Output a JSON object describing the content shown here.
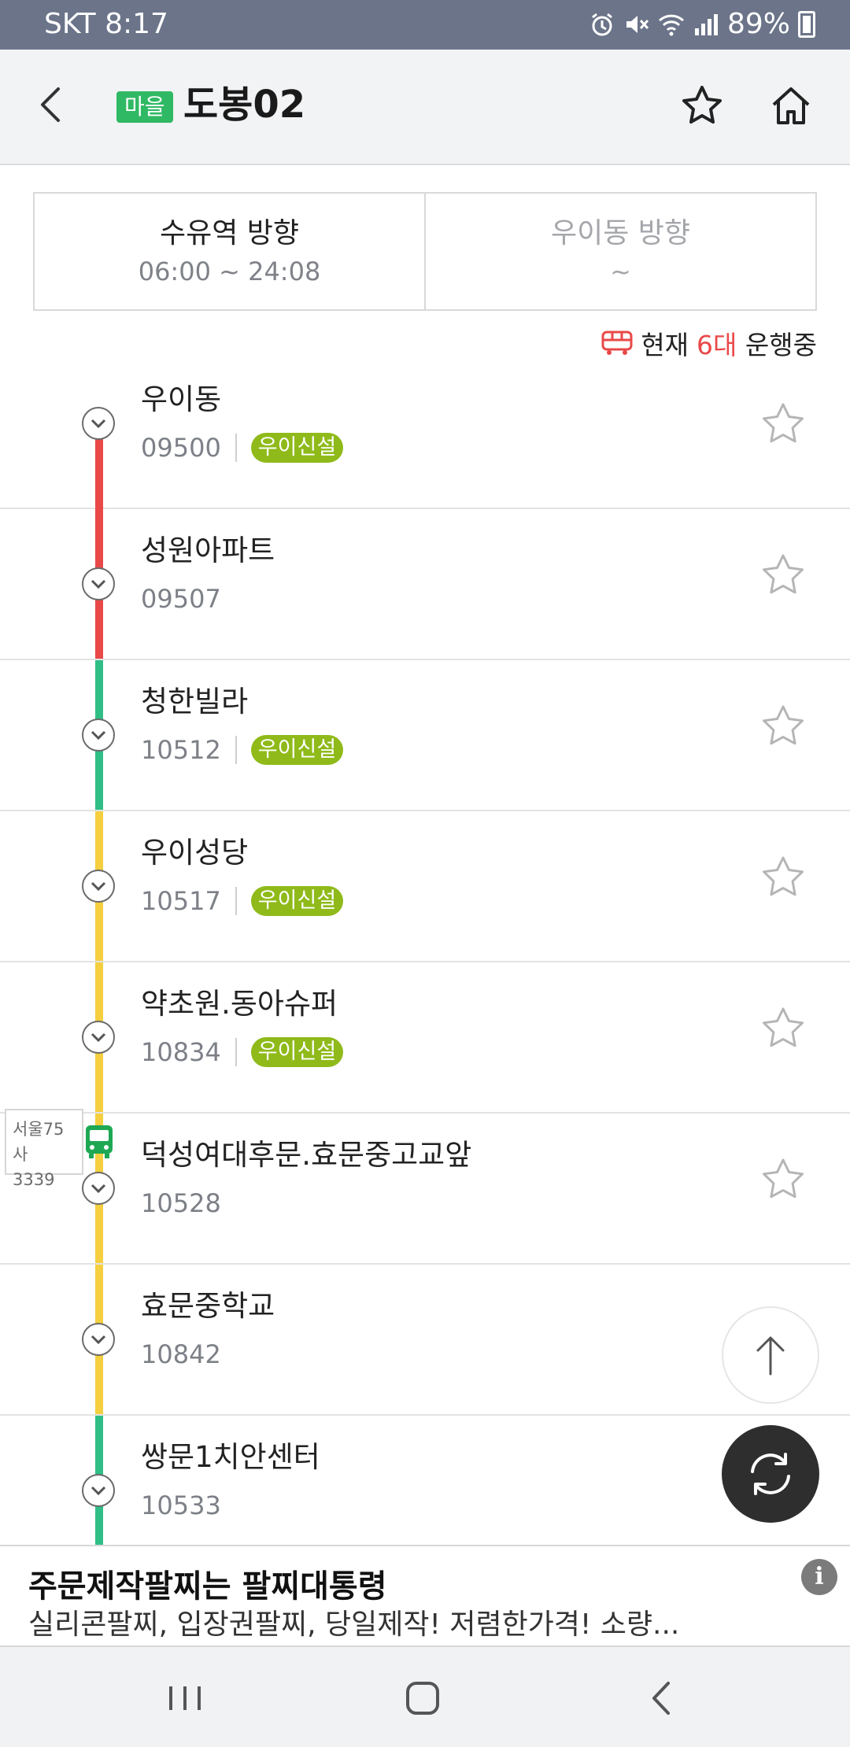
{
  "status_bar": {
    "carrier_time": "SKT 8:17",
    "battery": "89%"
  },
  "header": {
    "badge": "마을",
    "title": "도봉02"
  },
  "directions": [
    {
      "label": "수유역 방향",
      "hours": "06:00 ~ 24:08",
      "active": true
    },
    {
      "label": "우이동 방향",
      "hours": "~",
      "active": false
    }
  ],
  "running": {
    "prefix": "현재",
    "count": "6대",
    "suffix": "운행중"
  },
  "stops": [
    {
      "name": "우이동",
      "id": "09500",
      "tag": "우이신설"
    },
    {
      "name": "성원아파트",
      "id": "09507",
      "tag": ""
    },
    {
      "name": "청한빌라",
      "id": "10512",
      "tag": "우이신설"
    },
    {
      "name": "우이성당",
      "id": "10517",
      "tag": "우이신설"
    },
    {
      "name": "약초원.동아슈퍼",
      "id": "10834",
      "tag": "우이신설"
    },
    {
      "name": "덕성여대후문.효문중고교앞",
      "id": "10528",
      "tag": ""
    },
    {
      "name": "효문중학교",
      "id": "10842",
      "tag": ""
    },
    {
      "name": "쌍문1치안센터",
      "id": "10533",
      "tag": ""
    }
  ],
  "bus": {
    "plate_line1": "서울75사",
    "plate_line2": "3339"
  },
  "ad": {
    "title": "주문제작팔찌는 팔찌대통령",
    "description": "실리콘팔찌, 입장권팔찌, 당일제작! 저렴한가격! 소량...",
    "info": "i"
  },
  "colors": {
    "badge": "#30b964",
    "congestion_high": "#e94848",
    "congestion_low": "#2fbf86",
    "congestion_mid": "#f5cf3f",
    "tag": "#8fba1a",
    "bus": "#1fa854"
  }
}
